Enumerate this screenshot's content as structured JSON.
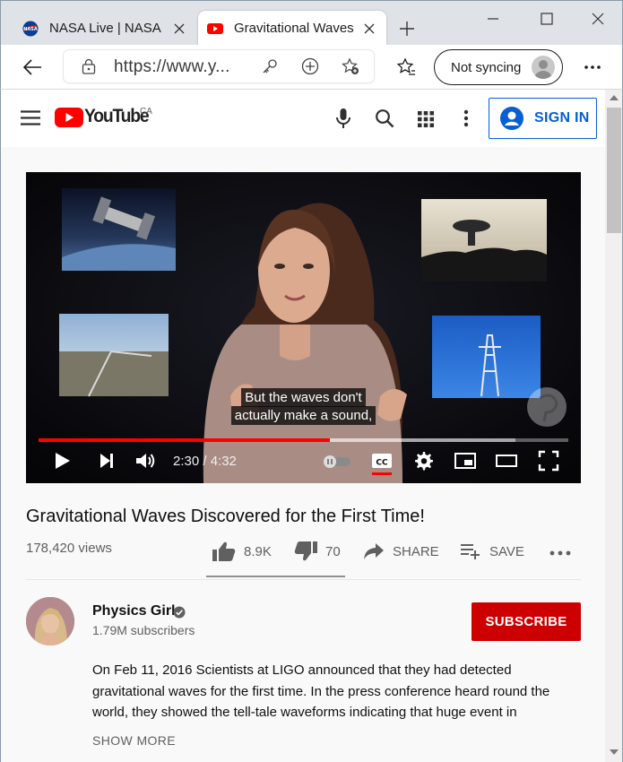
{
  "browser": {
    "tabs": [
      {
        "title": "NASA Live | NASA",
        "active": false
      },
      {
        "title": "Gravitational Waves Discovered for the First Time!",
        "active": true
      }
    ],
    "address": {
      "url": "https://www.y..."
    },
    "sync_label": "Not syncing"
  },
  "youtube": {
    "logo_text": "YouTube",
    "country_code": "CA",
    "sign_in_label": "SIGN IN",
    "colors": {
      "brand_red": "#ff0000",
      "link_blue": "#065fd4",
      "subscribe_red": "#cc0000"
    }
  },
  "player": {
    "caption_line1": "But the waves don't",
    "caption_line2": "actually make a sound,",
    "time": "2:30 / 4:32",
    "progress_fraction": 0.55,
    "buffered_fraction": 0.9
  },
  "video": {
    "title": "Gravitational Waves Discovered for the First Time!",
    "views": "178,420 views",
    "likes": "8.9K",
    "dislikes": "70",
    "share_label": "SHARE",
    "save_label": "SAVE"
  },
  "channel": {
    "name": "Physics Girl",
    "subscribers": "1.79M subscribers",
    "subscribe_label": "SUBSCRIBE"
  },
  "description": {
    "text": "On Feb 11, 2016 Scientists at LIGO announced that they had detected gravitational waves for the first time. In the press conference heard round the world, they showed the tell-tale waveforms indicating that huge event in",
    "show_more_label": "SHOW MORE"
  }
}
